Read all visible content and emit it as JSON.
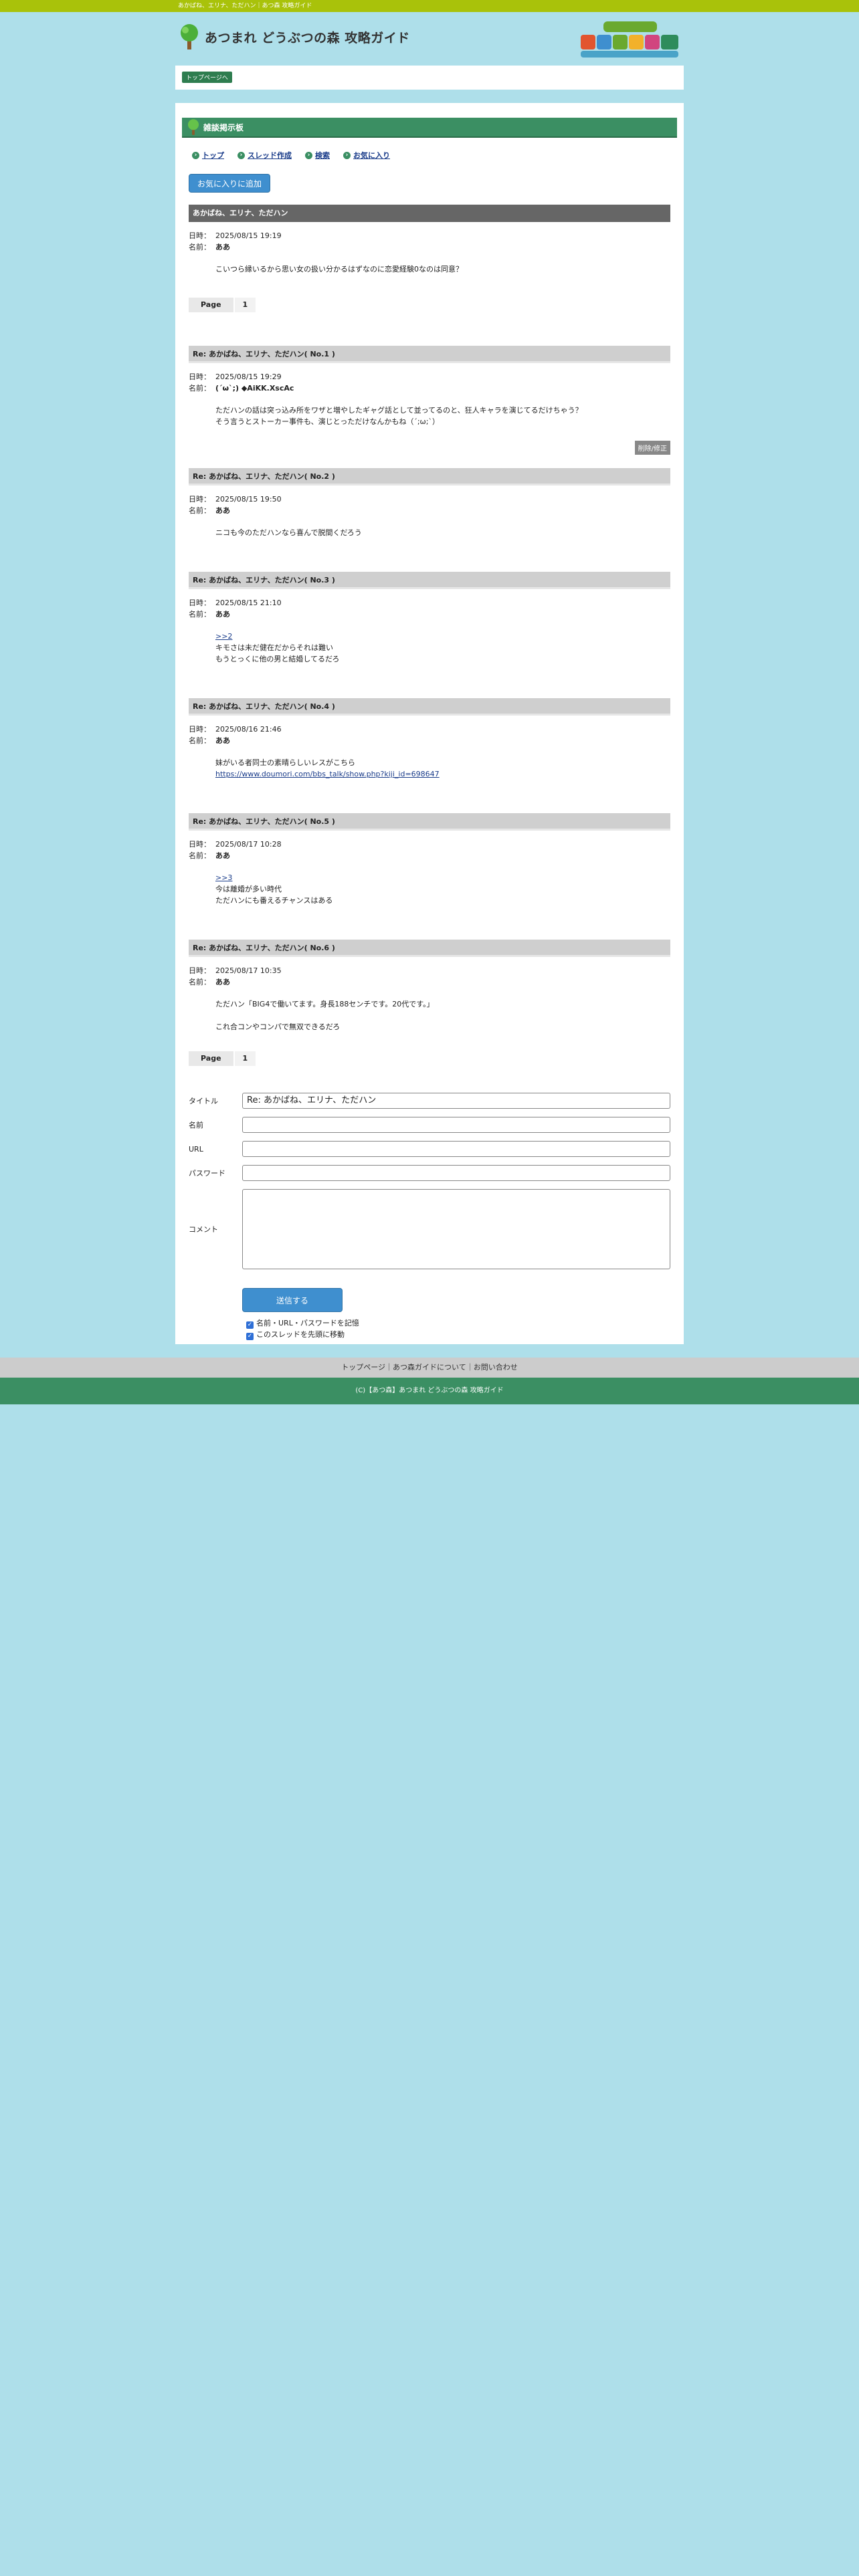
{
  "topbar": {
    "text": "あかばね、エリナ、ただハン｜あつ森 攻略ガイド"
  },
  "header": {
    "site_title": "あつまれ どうぶつの森 攻略ガイド"
  },
  "breadcrumb": {
    "top_label": "トップページへ"
  },
  "board": {
    "title": "雑談掲示板"
  },
  "nav": {
    "top": "トップ",
    "new_thread": "スレッド作成",
    "search": "検索",
    "favorites": "お気に入り"
  },
  "fav_button": "お気に入りに追加",
  "labels": {
    "date": "日時：",
    "name": "名前：",
    "page": "Page",
    "page_num": "1",
    "edit": "削除/修正"
  },
  "thread": {
    "title": "あかばね、エリナ、ただハン",
    "date": "2025/08/15 19:19",
    "name": "ああ",
    "body": [
      "こいつら縁いるから思い女の扱い分かるはずなのに恋愛経験0なのは同意？"
    ]
  },
  "replies": [
    {
      "title": "Re: あかばね、エリナ、ただハン( No.1 )",
      "date": "2025/08/15 19:29",
      "name": "(´ω`;) ◆AiKK.XscAc",
      "body": [
        "ただハンの話は突っ込み所をワザと増やしたギャグ話として並ってるのと、狂人キャラを演じてるだけちゃう？",
        "そう言うとストーカー事件も、演じとっただけなんかもね（´;ω;`）"
      ]
    },
    {
      "title": "Re: あかばね、エリナ、ただハン( No.2 )",
      "date": "2025/08/15 19:50",
      "name": "ああ",
      "body": [
        "ニコも今のただハンなら喜んで脱間くだろう"
      ]
    },
    {
      "title": "Re: あかばね、エリナ、ただハン( No.3 )",
      "date": "2025/08/15 21:10",
      "name": "ああ",
      "link": ">>2",
      "body": [
        "キモさは未だ健在だからそれは難い",
        "もうとっくに他の男と結婚してるだろ"
      ]
    },
    {
      "title": "Re: あかばね、エリナ、ただハン( No.4 )",
      "date": "2025/08/16 21:46",
      "name": "ああ",
      "body": [
        "妹がいる者同士の素晴らしいレスがこちら"
      ],
      "url": "https://www.doumori.com/bbs_talk/show.php?kiji_id=698647"
    },
    {
      "title": "Re: あかばね、エリナ、ただハン( No.5 )",
      "date": "2025/08/17 10:28",
      "name": "ああ",
      "link": ">>3",
      "body": [
        "今は離婚が多い時代",
        "ただハンにも番えるチャンスはある"
      ]
    },
    {
      "title": "Re: あかばね、エリナ、ただハン( No.6 )",
      "date": "2025/08/17 10:35",
      "name": "ああ",
      "body": [
        "ただハン「BIG4で働いてます。身長188センチです。20代です。」",
        "",
        "これ合コンやコンパで無双できるだろ"
      ]
    }
  ],
  "form": {
    "title_label": "タイトル",
    "title_value": "Re: あかばね、エリナ、ただハン",
    "name_label": "名前",
    "url_label": "URL",
    "password_label": "パスワード",
    "comment_label": "コメント",
    "submit": "送信する",
    "check1": "名前・URL・パスワードを記憶",
    "check2": "このスレッドを先頭に移動"
  },
  "footer": {
    "links": "トップページ｜あつ森ガイドについて｜お問い合わせ",
    "copyright": "(C)【あつ森】あつまれ どうぶつの森 攻略ガイド"
  }
}
